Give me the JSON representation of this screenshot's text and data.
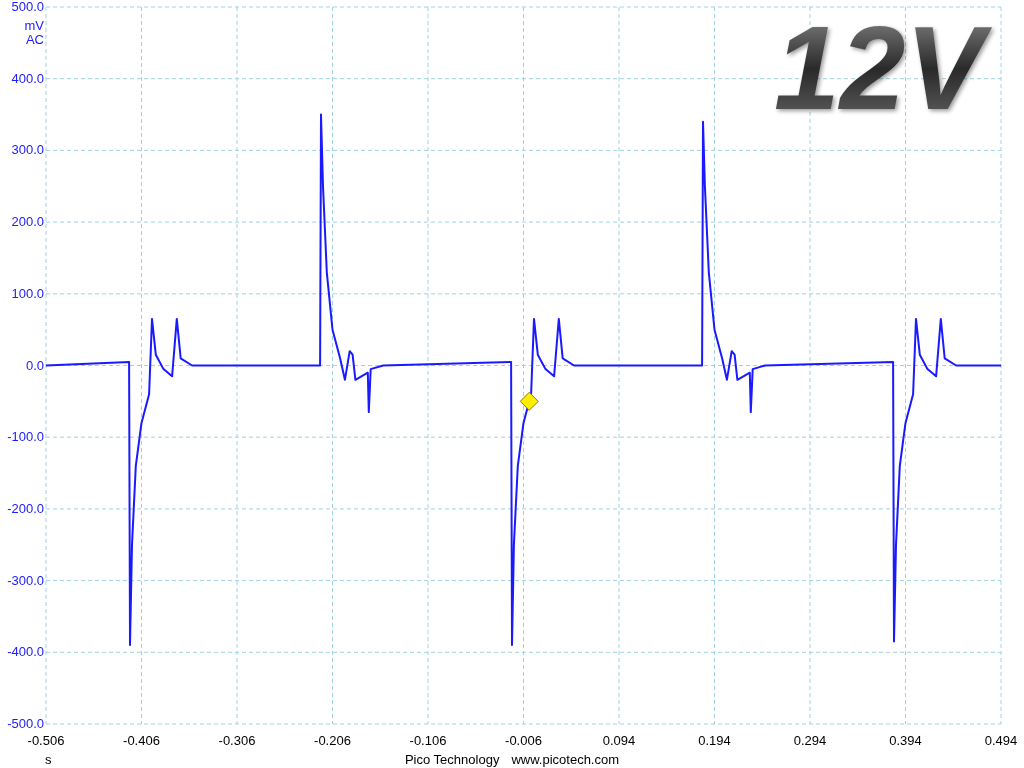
{
  "scope": {
    "chart_data": {
      "type": "line",
      "title": "12V",
      "xlabel": "s",
      "ylabel": "mV",
      "xlim": [
        -0.506,
        0.494
      ],
      "ylim": [
        -500,
        500
      ],
      "xticks": [
        {
          "value": -0.506,
          "label": "-0.506"
        },
        {
          "value": -0.406,
          "label": "-0.406"
        },
        {
          "value": -0.306,
          "label": "-0.306"
        },
        {
          "value": -0.206,
          "label": "-0.206"
        },
        {
          "value": -0.106,
          "label": "-0.106"
        },
        {
          "value": -0.006,
          "label": "-0.006"
        },
        {
          "value": 0.094,
          "label": "0.094"
        },
        {
          "value": 0.194,
          "label": "0.194"
        },
        {
          "value": 0.294,
          "label": "0.294"
        },
        {
          "value": 0.394,
          "label": "0.394"
        },
        {
          "value": 0.494,
          "label": "0.494"
        }
      ],
      "yticks": [
        {
          "value": 500,
          "label": "500.0"
        },
        {
          "value": 400,
          "label": "400.0"
        },
        {
          "value": 300,
          "label": "300.0"
        },
        {
          "value": 200,
          "label": "200.0"
        },
        {
          "value": 100,
          "label": "100.0"
        },
        {
          "value": 0,
          "label": "0.0"
        },
        {
          "value": -100,
          "label": "-100.0"
        },
        {
          "value": -200,
          "label": "-200.0"
        },
        {
          "value": -300,
          "label": "-300.0"
        },
        {
          "value": -400,
          "label": "-400.0"
        },
        {
          "value": -500,
          "label": "-500.0"
        }
      ],
      "x": [
        -0.506,
        -0.419,
        -0.418,
        -0.416,
        -0.412,
        -0.406,
        -0.398,
        -0.395,
        -0.391,
        -0.383,
        -0.374,
        -0.369,
        -0.365,
        -0.353,
        -0.219,
        -0.218,
        -0.216,
        -0.212,
        -0.206,
        -0.198,
        -0.193,
        -0.188,
        -0.185,
        -0.182,
        -0.169,
        -0.168,
        -0.166,
        -0.153,
        -0.019,
        -0.018,
        -0.016,
        -0.012,
        -0.006,
        0.002,
        0.005,
        0.009,
        0.017,
        0.026,
        0.031,
        0.035,
        0.047,
        0.181,
        0.182,
        0.184,
        0.188,
        0.194,
        0.202,
        0.207,
        0.212,
        0.215,
        0.218,
        0.231,
        0.232,
        0.234,
        0.247,
        0.381,
        0.382,
        0.384,
        0.388,
        0.394,
        0.402,
        0.405,
        0.409,
        0.417,
        0.426,
        0.431,
        0.435,
        0.447,
        0.494
      ],
      "series": [
        {
          "color": "#1a1aff",
          "values": [
            0,
            5,
            -390,
            -250,
            -140,
            -80,
            -40,
            65,
            15,
            -5,
            -15,
            65,
            10,
            0,
            0,
            350,
            250,
            130,
            50,
            10,
            -20,
            20,
            15,
            -20,
            -10,
            -65,
            -5,
            0,
            5,
            -390,
            -250,
            -140,
            -80,
            -40,
            65,
            15,
            -5,
            -15,
            65,
            10,
            0,
            0,
            340,
            250,
            130,
            50,
            10,
            -20,
            20,
            15,
            -20,
            -10,
            -65,
            -5,
            0,
            5,
            -385,
            -250,
            -140,
            -80,
            -40,
            65,
            15,
            -5,
            -15,
            65,
            10,
            0,
            0
          ]
        }
      ],
      "grid": true
    },
    "trigger_marker": true,
    "coupling": "AC",
    "footer": [
      "Pico Technology",
      "www.picotech.com"
    ]
  }
}
